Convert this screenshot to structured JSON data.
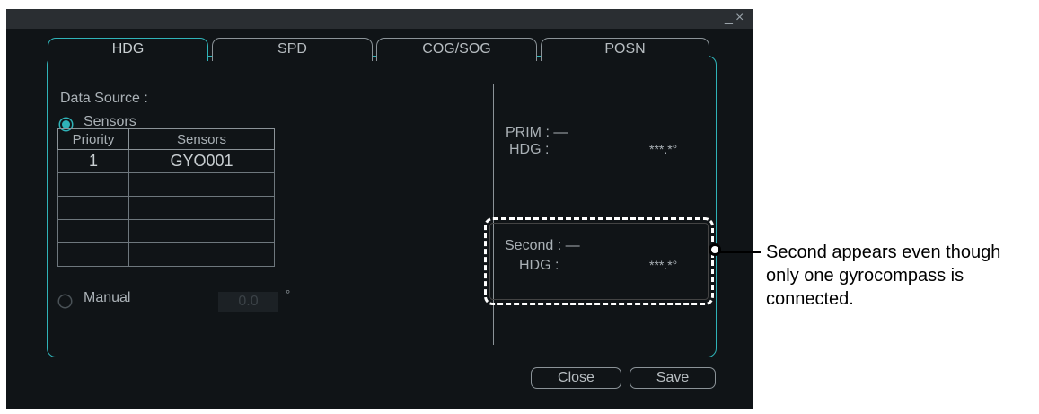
{
  "window": {
    "minimize_glyph": "_",
    "close_glyph": "×"
  },
  "tabs": [
    {
      "label": "HDG",
      "active": true
    },
    {
      "label": "SPD",
      "active": false
    },
    {
      "label": "COG/SOG",
      "active": false
    },
    {
      "label": "POSN",
      "active": false
    }
  ],
  "data_source": {
    "label": "Data Source :",
    "sensors_option": "Sensors",
    "sensors_selected": true,
    "table": {
      "headers": [
        "Priority",
        "Sensors"
      ],
      "rows": [
        [
          "1",
          "GYO001"
        ],
        [
          "",
          ""
        ],
        [
          "",
          ""
        ],
        [
          "",
          ""
        ],
        [
          "",
          ""
        ]
      ]
    },
    "manual_option": "Manual",
    "manual_value": "0.0",
    "manual_unit": "°"
  },
  "status": {
    "prim_label": "PRIM : —",
    "prim_hdg_label": "HDG :",
    "prim_hdg_value": "***.*°",
    "second_label": "Second : —",
    "second_hdg_label": "HDG :",
    "second_hdg_value": "***.*°"
  },
  "buttons": {
    "close": "Close",
    "save": "Save"
  },
  "callout": {
    "text": "Second appears even though only one gyrocompass is connected."
  },
  "colors": {
    "accent": "#2fb3b8",
    "background": "#101417",
    "text": "#aab1b6"
  }
}
